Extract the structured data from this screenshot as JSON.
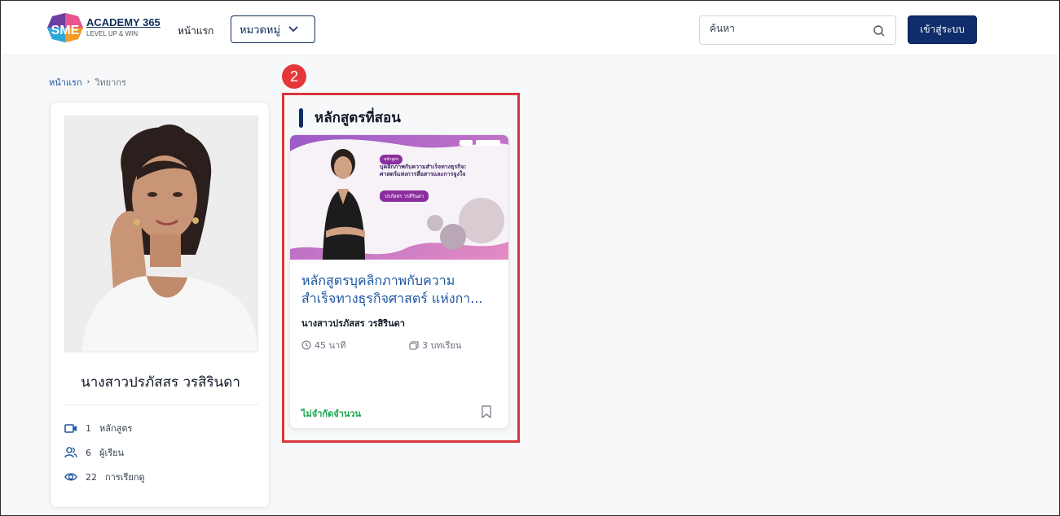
{
  "header": {
    "logo": {
      "mark": "SME",
      "name": "ACADEMY 365",
      "tagline": "LEVEL UP & WIN"
    },
    "nav_home": "หน้าแรก",
    "category_label": "หมวดหมู่",
    "search_placeholder": "ค้นหา",
    "login_label": "เข้าสู่ระบบ"
  },
  "breadcrumb": {
    "home": "หน้าแรก",
    "separator": "›",
    "current": "วิทยากร"
  },
  "profile": {
    "name": "นางสาวปรภัสสร วรสิรินดา",
    "stats": [
      {
        "icon": "video-camera-icon",
        "value": "1",
        "label": "หลักสูตร"
      },
      {
        "icon": "users-icon",
        "value": "6",
        "label": "ผู้เรียน"
      },
      {
        "icon": "eye-icon",
        "value": "22",
        "label": "การเรียกดู"
      }
    ]
  },
  "annotation": {
    "number": "2"
  },
  "courses_section": {
    "title": "หลักสูตรที่สอน",
    "courses": [
      {
        "thumbnail": {
          "tag": "หลักสูตร",
          "title": "บุคลิกภาพกับความสำเร็จทางธุรกิจ: ศาสตร์แห่งการสื่อสารและการจูงใจ",
          "presenter": "ปรภัสสร วรสิรินดา"
        },
        "title_line1": "หลักสูตรบุคลิกภาพกับความ",
        "title_line2": "สำเร็จทางธุรกิจศาสตร์ แห่งกา...",
        "instructor": "นางสาวปรภัสสร วรสิรินดา",
        "duration": "45 นาที",
        "lessons": "3 บทเรียน",
        "availability": "ไม่จำกัดจำนวน"
      }
    ]
  },
  "colors": {
    "brand_navy": "#0f2d6b",
    "link_blue": "#1e56a0",
    "annotation_red": "#e5373a",
    "available_green": "#16a34a"
  }
}
